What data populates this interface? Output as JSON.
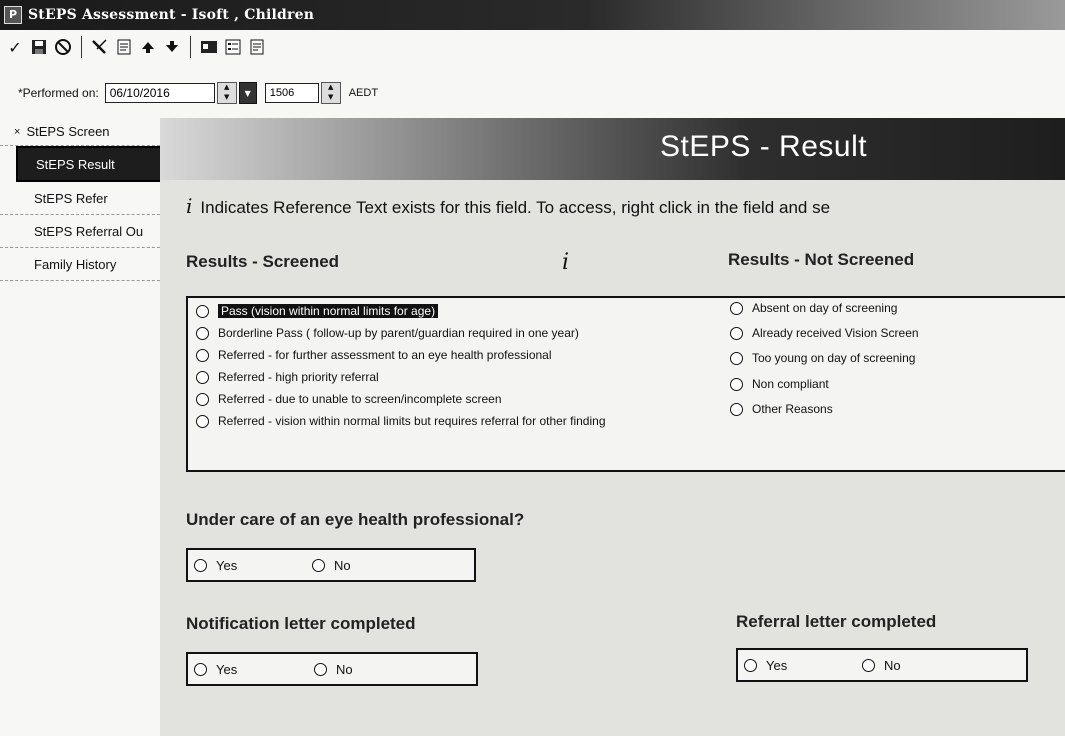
{
  "window": {
    "title": "StEPS Assessment - Isoft , Children",
    "app_icon_letter": "P"
  },
  "toolbar": {
    "icons": [
      "check-icon",
      "save-icon",
      "cancel-icon",
      "tools-icon",
      "notes-icon",
      "up-arrow-icon",
      "down-arrow-icon",
      "card-icon",
      "list-icon",
      "print-icon"
    ]
  },
  "performed": {
    "label": "*Performed on:",
    "date": "06/10/2016",
    "time": "1506",
    "timezone": "AEDT"
  },
  "sidebar": {
    "items": [
      {
        "label": "StEPS Screen",
        "prefix": "×"
      },
      {
        "label": "StEPS Result"
      },
      {
        "label": "StEPS Refer"
      },
      {
        "label": "StEPS Referral Ou"
      },
      {
        "label": "Family History"
      }
    ]
  },
  "main": {
    "header_title": "StEPS - Result",
    "info_icon": "i",
    "info_text": "Indicates Reference Text exists for this field. To access, right click in the field and se",
    "screened_label": "Results - Screened",
    "not_screened_label": "Results - Not Screened",
    "screened_options": [
      "Pass (vision within normal limits for age)",
      "Borderline Pass ( follow-up by parent/guardian required in one year)",
      "Referred - for further assessment to an eye health professional",
      "Referred - high priority referral",
      "Referred - due to unable to screen/incomplete screen",
      "Referred - vision within normal limits but requires referral for other finding"
    ],
    "not_screened_options": [
      "Absent on day of screening",
      "Already received Vision Screen",
      "Too young on day of screening",
      "Non compliant",
      "Other Reasons"
    ],
    "eye_care_label": "Under care of an eye health professional?",
    "notification_label": "Notification letter completed",
    "referral_label": "Referral letter completed",
    "yes": "Yes",
    "no": "No"
  }
}
